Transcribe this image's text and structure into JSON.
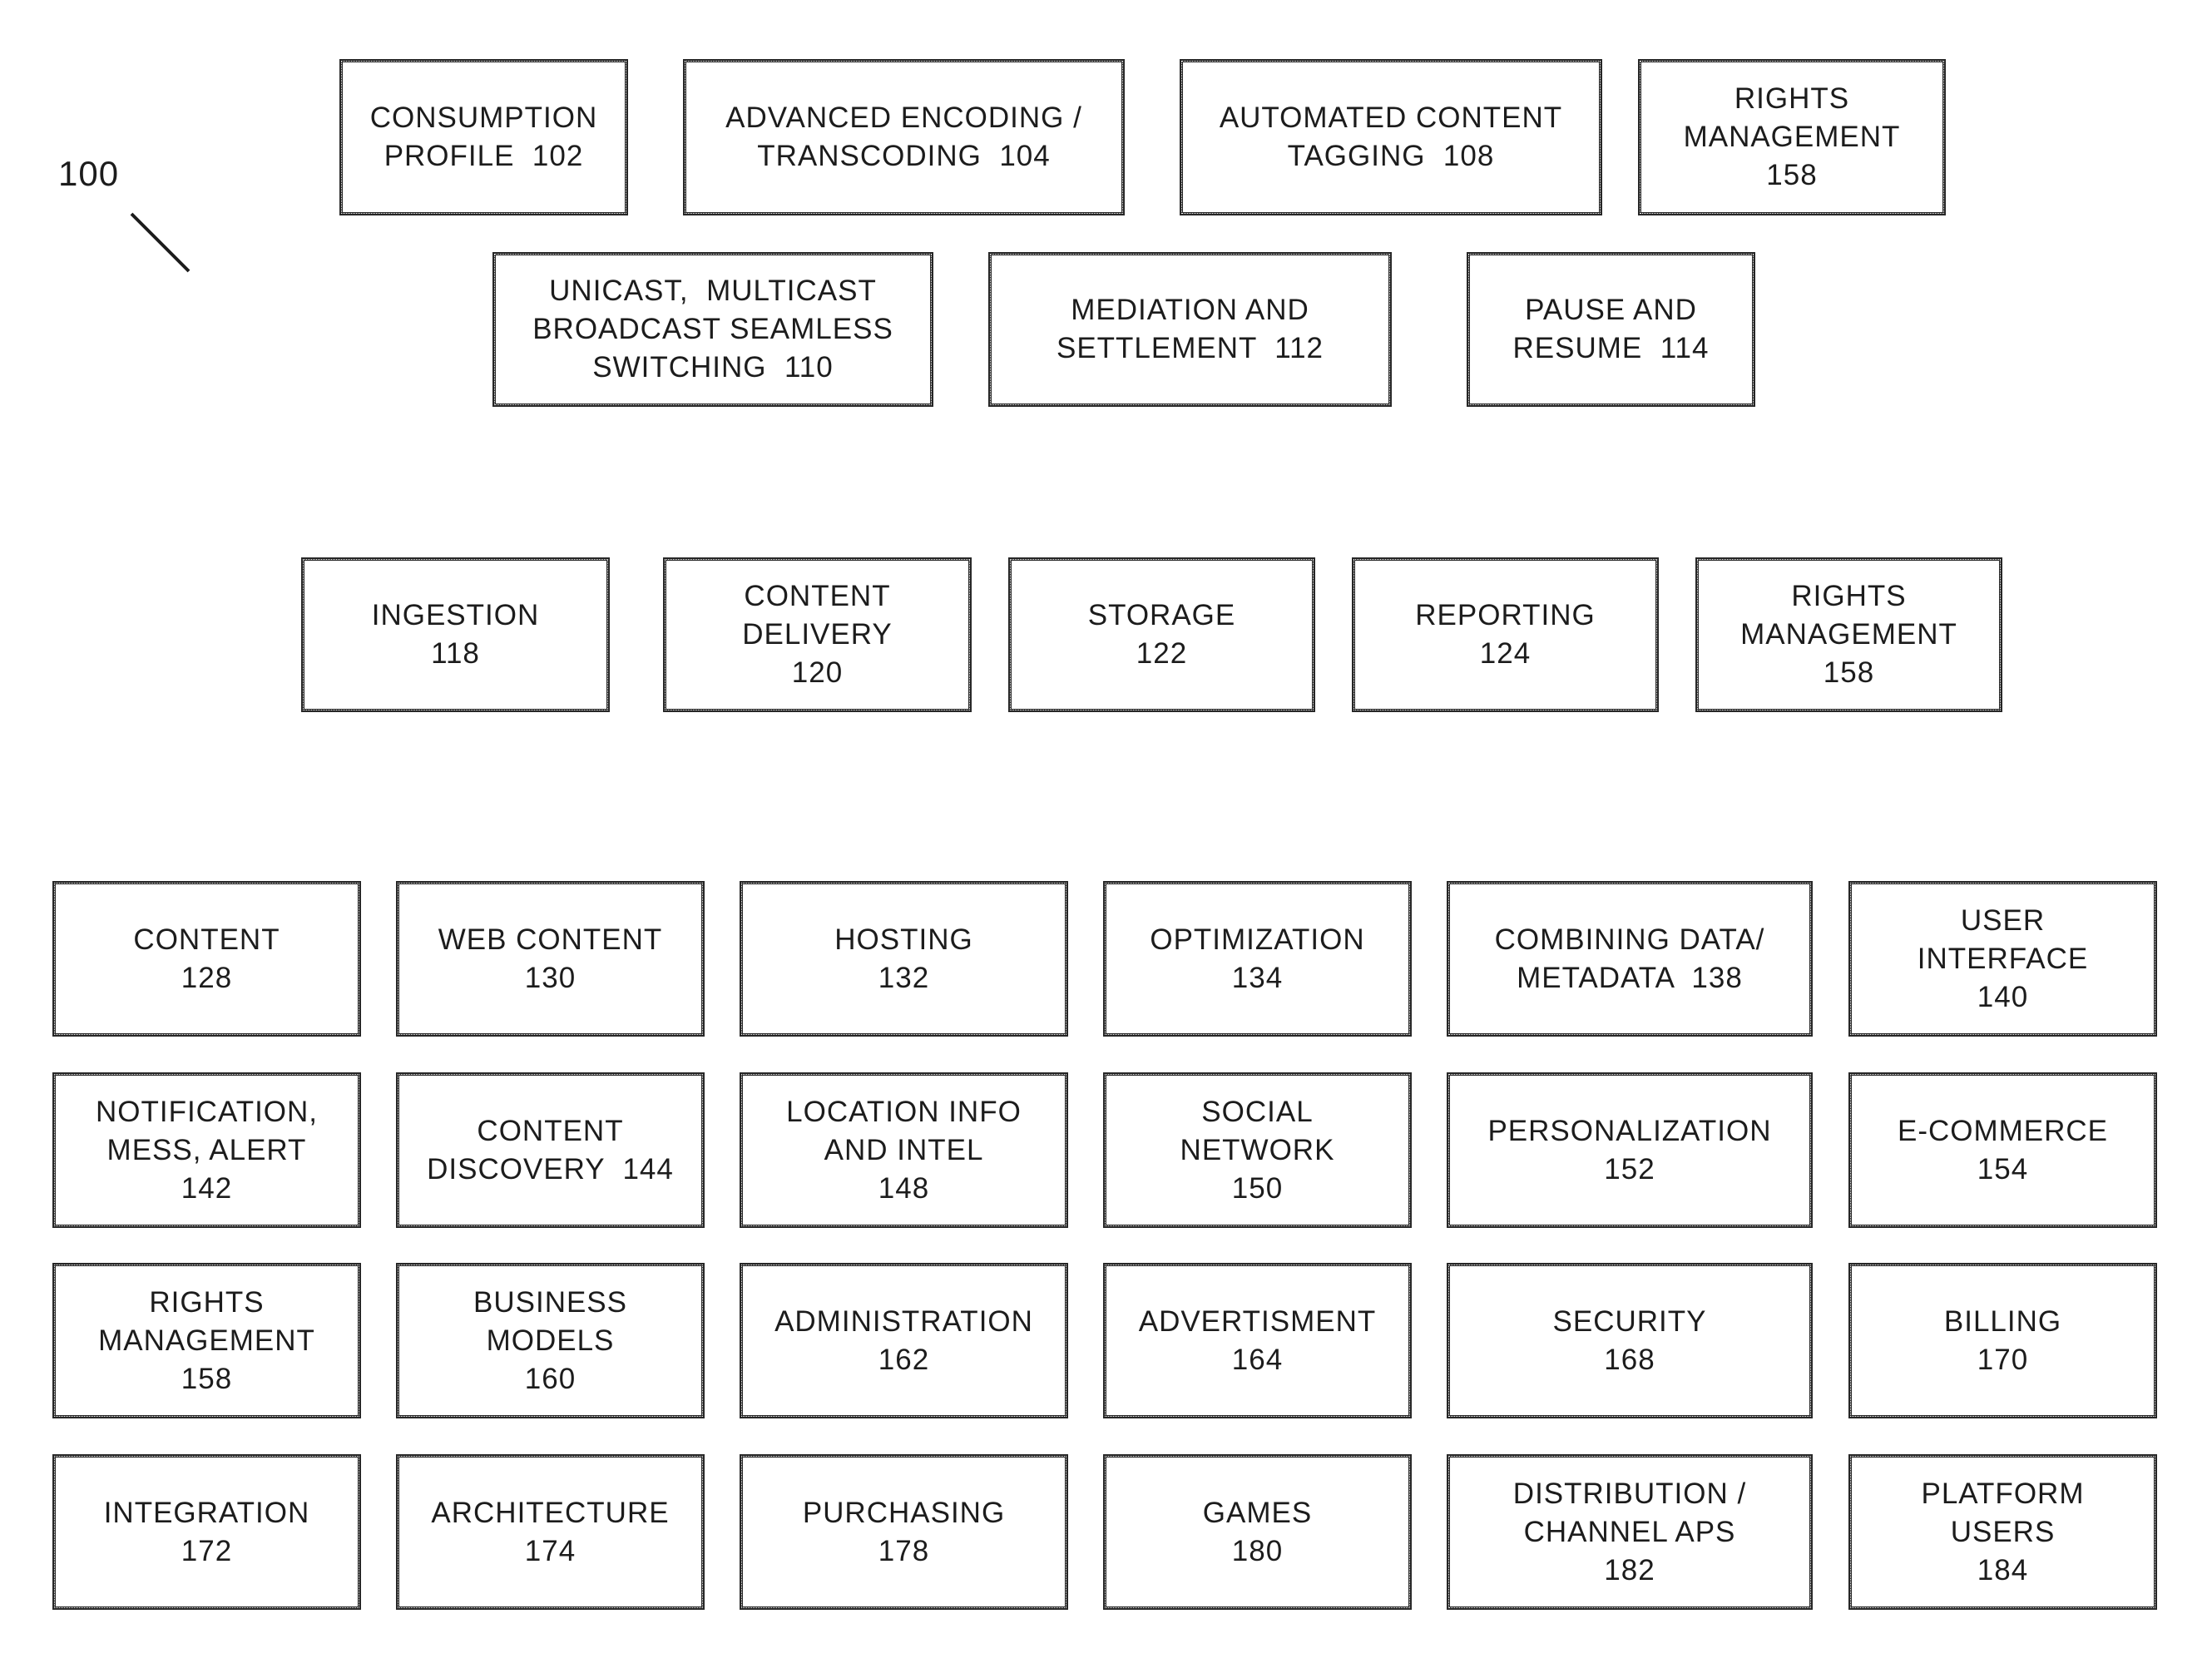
{
  "figure": {
    "reference_label": "100",
    "blocks": [
      {
        "id": "consumption-profile",
        "lines": [
          "CONSUMPTION",
          "PROFILE  102"
        ]
      },
      {
        "id": "advanced-encoding",
        "lines": [
          "ADVANCED ENCODING /",
          "TRANSCODING  104"
        ]
      },
      {
        "id": "automated-content-tagging",
        "lines": [
          "AUTOMATED CONTENT",
          "TAGGING  108"
        ]
      },
      {
        "id": "rights-management-top",
        "lines": [
          "RIGHTS",
          "MANAGEMENT",
          "158"
        ]
      },
      {
        "id": "seamless-switching",
        "lines": [
          "UNICAST,  MULTICAST",
          "BROADCAST SEAMLESS",
          "SWITCHING  110"
        ]
      },
      {
        "id": "mediation-settlement",
        "lines": [
          "MEDIATION AND",
          "SETTLEMENT  112"
        ]
      },
      {
        "id": "pause-resume",
        "lines": [
          "PAUSE AND",
          "RESUME  114"
        ]
      },
      {
        "id": "ingestion",
        "lines": [
          "INGESTION",
          "118"
        ]
      },
      {
        "id": "content-delivery",
        "lines": [
          "CONTENT",
          "DELIVERY",
          "120"
        ]
      },
      {
        "id": "storage",
        "lines": [
          "STORAGE",
          "122"
        ]
      },
      {
        "id": "reporting",
        "lines": [
          "REPORTING",
          "124"
        ]
      },
      {
        "id": "rights-management-middle",
        "lines": [
          "RIGHTS",
          "MANAGEMENT",
          "158"
        ]
      },
      {
        "id": "content",
        "lines": [
          "CONTENT",
          "128"
        ]
      },
      {
        "id": "web-content",
        "lines": [
          "WEB CONTENT",
          "130"
        ]
      },
      {
        "id": "hosting",
        "lines": [
          "HOSTING",
          "132"
        ]
      },
      {
        "id": "optimization",
        "lines": [
          "OPTIMIZATION",
          "134"
        ]
      },
      {
        "id": "combining-data-metadata",
        "lines": [
          "COMBINING DATA/",
          "METADATA  138"
        ]
      },
      {
        "id": "user-interface",
        "lines": [
          "USER",
          "INTERFACE",
          "140"
        ]
      },
      {
        "id": "notification-alert",
        "lines": [
          "NOTIFICATION,",
          "MESS, ALERT",
          "142"
        ]
      },
      {
        "id": "content-discovery",
        "lines": [
          "CONTENT",
          "DISCOVERY  144"
        ]
      },
      {
        "id": "location-info",
        "lines": [
          "LOCATION INFO",
          "AND INTEL",
          "148"
        ]
      },
      {
        "id": "social-network",
        "lines": [
          "SOCIAL",
          "NETWORK",
          "150"
        ]
      },
      {
        "id": "personalization",
        "lines": [
          "PERSONALIZATION",
          "152"
        ]
      },
      {
        "id": "e-commerce",
        "lines": [
          "E-COMMERCE",
          "154"
        ]
      },
      {
        "id": "rights-management-grid",
        "lines": [
          "RIGHTS",
          "MANAGEMENT",
          "158"
        ]
      },
      {
        "id": "business-models",
        "lines": [
          "BUSINESS",
          "MODELS",
          "160"
        ]
      },
      {
        "id": "administration",
        "lines": [
          "ADMINISTRATION",
          "162"
        ]
      },
      {
        "id": "advertisment",
        "lines": [
          "ADVERTISMENT",
          "164"
        ]
      },
      {
        "id": "security",
        "lines": [
          "SECURITY",
          "168"
        ]
      },
      {
        "id": "billing",
        "lines": [
          "BILLING",
          "170"
        ]
      },
      {
        "id": "integration",
        "lines": [
          "INTEGRATION",
          "172"
        ]
      },
      {
        "id": "architecture",
        "lines": [
          "ARCHITECTURE",
          "174"
        ]
      },
      {
        "id": "purchasing",
        "lines": [
          "PURCHASING",
          "178"
        ]
      },
      {
        "id": "games",
        "lines": [
          "GAMES",
          "180"
        ]
      },
      {
        "id": "distribution-channel-aps",
        "lines": [
          "DISTRIBUTION /",
          "CHANNEL APS",
          "182"
        ]
      },
      {
        "id": "platform-users",
        "lines": [
          "PLATFORM",
          "USERS",
          "184"
        ]
      }
    ]
  }
}
